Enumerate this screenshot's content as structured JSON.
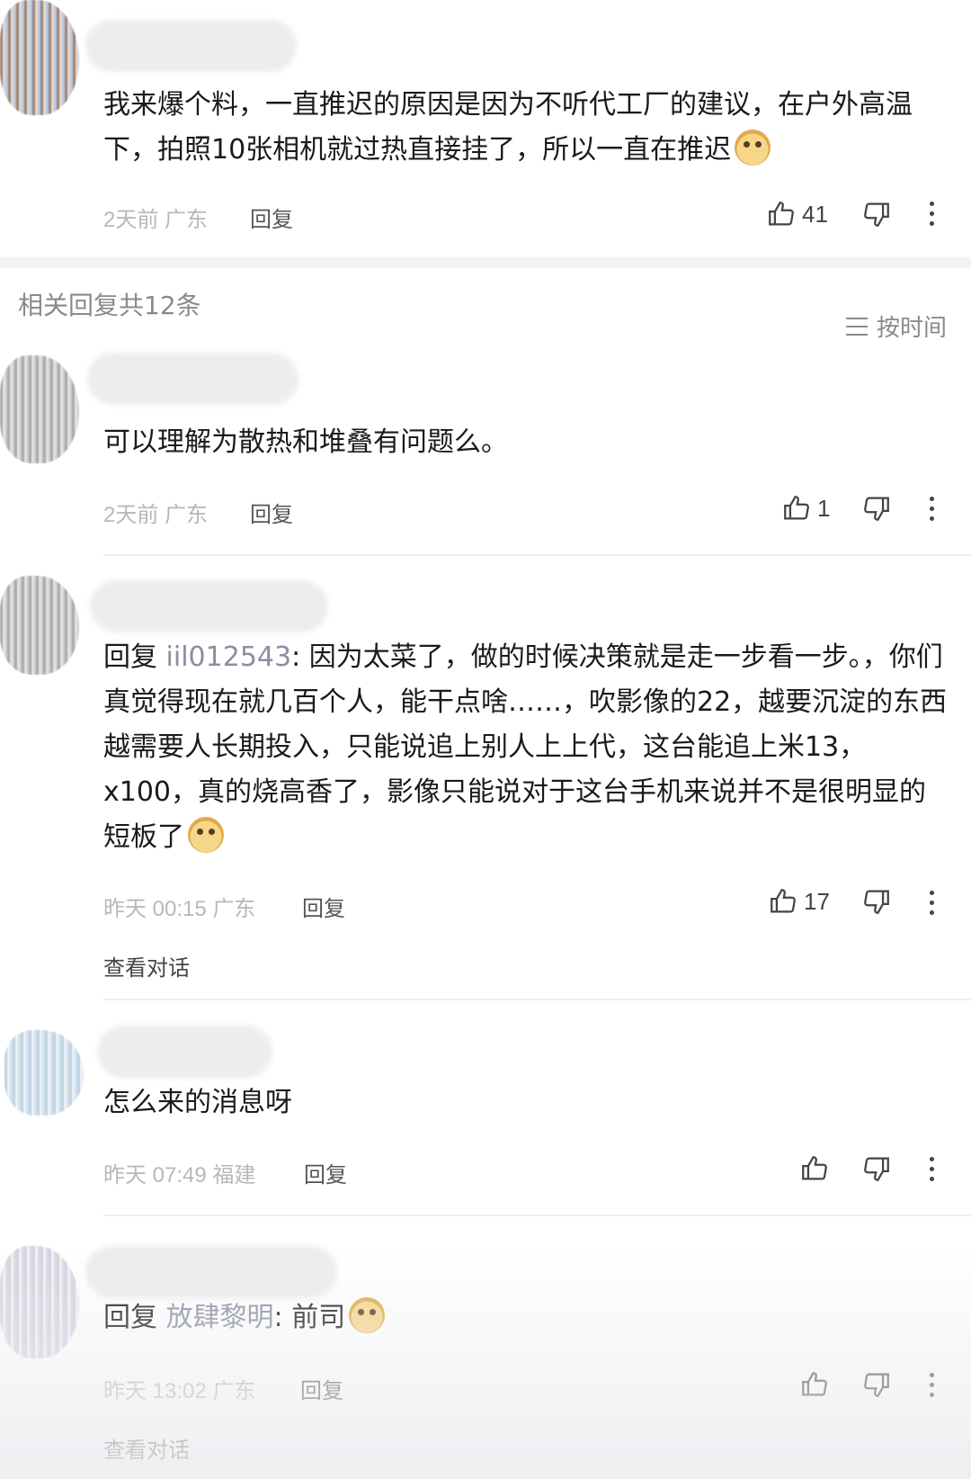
{
  "main_comment": {
    "text": "我来爆个料，一直推迟的原因是因为不听代工厂的建议，在户外高温下，拍照10张相机就过热直接挂了，所以一直在推迟",
    "time": "2天前",
    "region": "广东",
    "reply_label": "回复",
    "likes": "41"
  },
  "replies_header": {
    "title": "相关回复共12条",
    "sort_label": "按时间"
  },
  "replies": [
    {
      "text": "可以理解为散热和堆叠有问题么。",
      "time": "2天前",
      "region": "广东",
      "reply_label": "回复",
      "likes": "1"
    },
    {
      "prefix": "回复",
      "quote_user": "iil012543",
      "text": ": 因为太菜了，做的时候决策就是走一步看一步。，你们真觉得现在就几百个人，能干点啥……，吹影像的22，越要沉淀的东西越需要人长期投入，只能说追上别人上上代，这台能追上米13，x100，真的烧高香了，影像只能说对于这台手机来说并不是很明显的短板了",
      "time": "昨天 00:15",
      "region": "广东",
      "reply_label": "回复",
      "likes": "17",
      "view_conversation": "查看对话"
    },
    {
      "text": "怎么来的消息呀",
      "time": "昨天 07:49",
      "region": "福建",
      "reply_label": "回复",
      "likes": ""
    },
    {
      "prefix": "回复",
      "quote_user": "放肆黎明",
      "text": ": 前司",
      "time": "昨天 13:02",
      "region": "广东",
      "reply_label": "回复",
      "likes": "",
      "view_conversation": "查看对话"
    }
  ],
  "icons": {
    "like": "thumbs-up-icon",
    "dislike": "thumbs-down-icon",
    "more": "more-vertical-icon",
    "emoji": "doge-emoji-icon",
    "sort": "list-sort-icon"
  }
}
